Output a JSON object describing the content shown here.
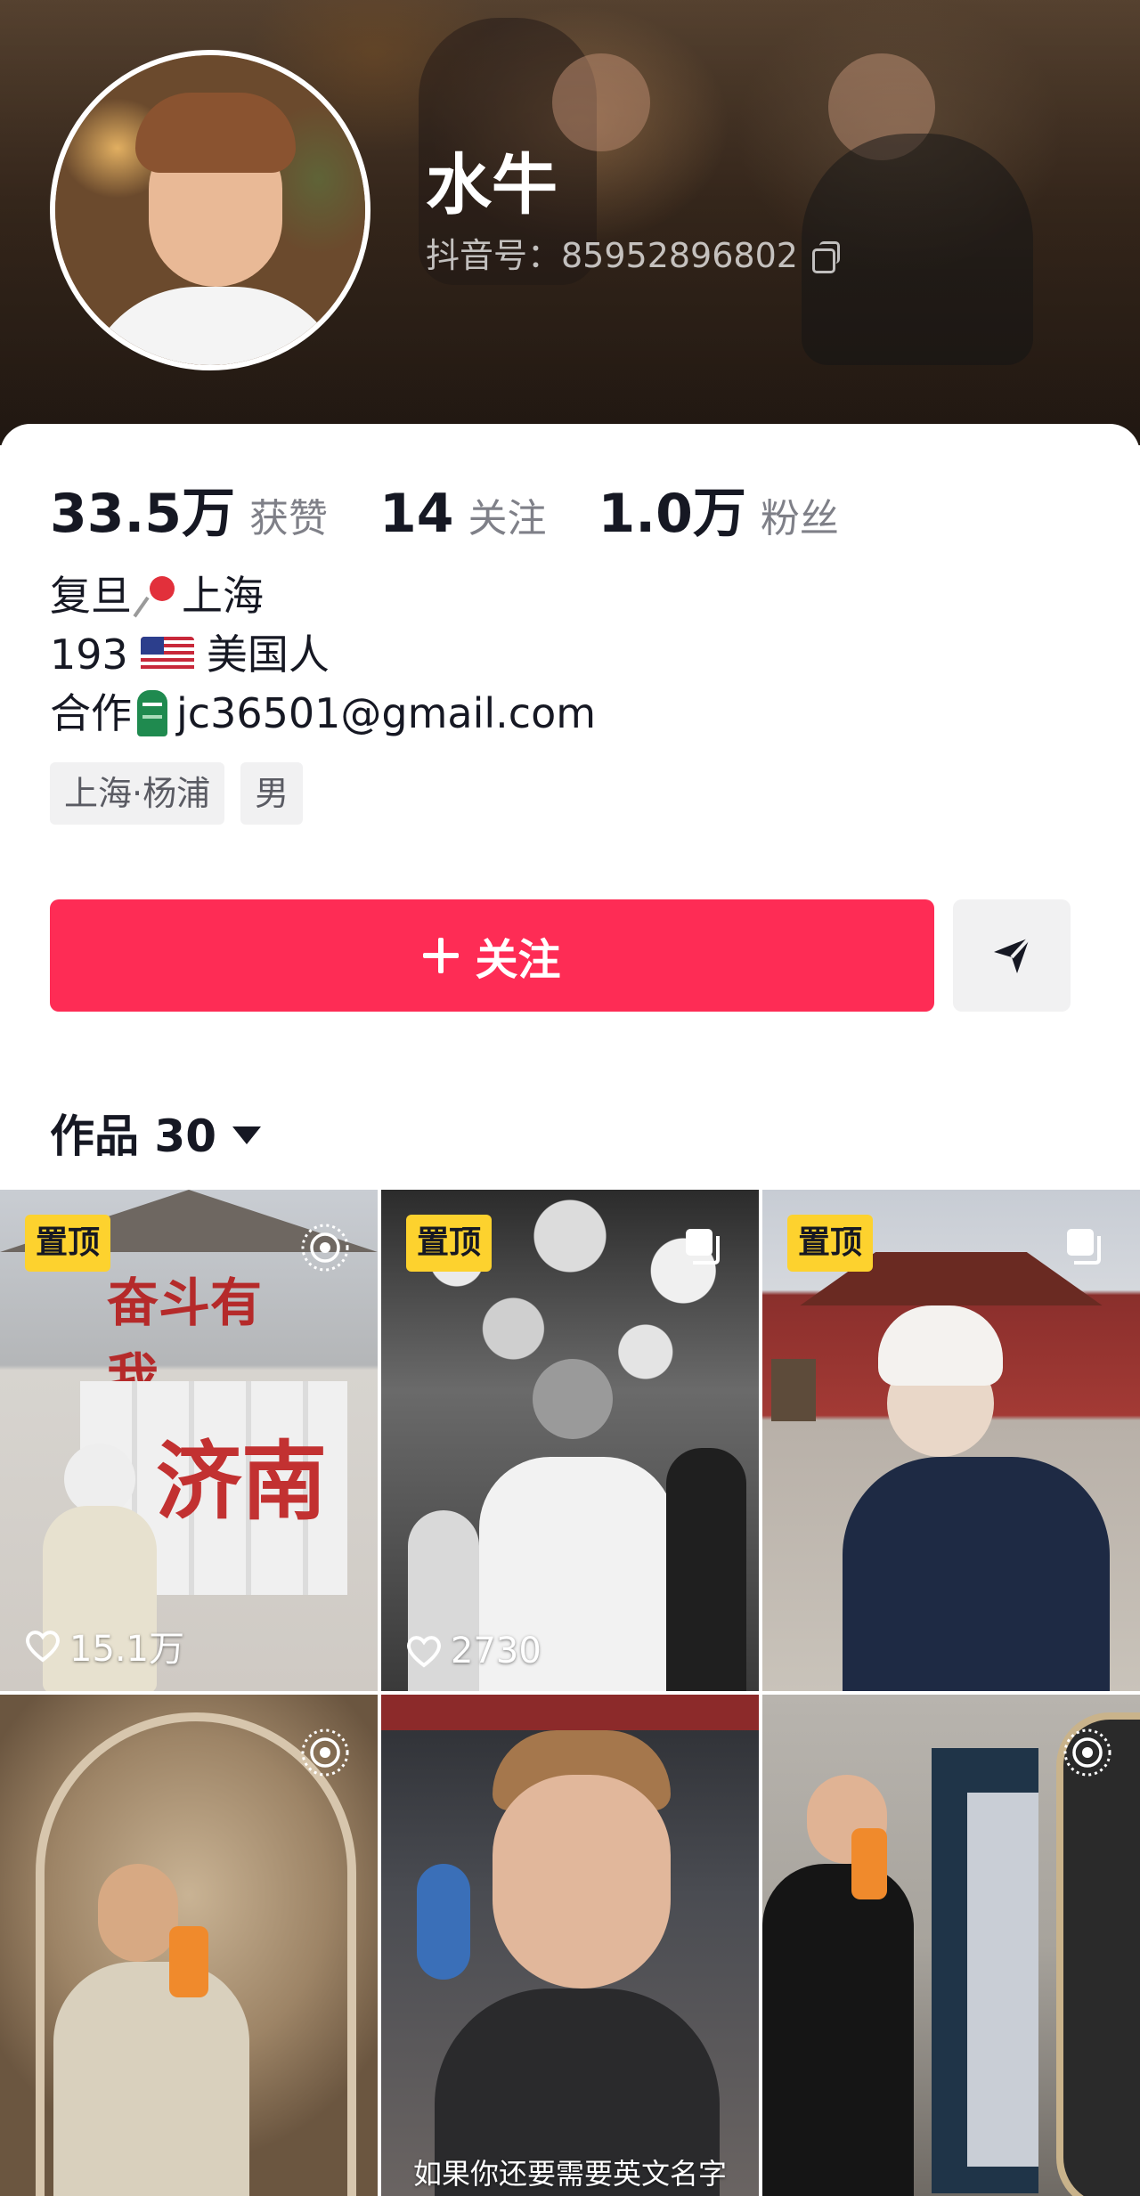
{
  "profile": {
    "name": "水牛",
    "douyin_id": "抖音号：85952896802"
  },
  "stats": {
    "likes_value": "33.5万",
    "likes_label": "获赞",
    "following_value": "14",
    "following_label": "关注",
    "followers_value": "1.0万",
    "followers_label": "粉丝"
  },
  "bio": {
    "line1_a": "复旦",
    "line1_b": "上海",
    "line2_a": "193",
    "line2_b": "美国人",
    "line3_a": "合作",
    "line3_b": "jc36501@gmail.com"
  },
  "tags": [
    "上海·杨浦",
    "男"
  ],
  "actions": {
    "follow_label": "关注"
  },
  "works": {
    "label": "作品 30"
  },
  "grid": {
    "pinned_label": "置顶",
    "items": [
      {
        "likes": "15.1万"
      },
      {
        "likes": "2730"
      },
      {
        "likes": ""
      },
      {
        "likes": ""
      },
      {
        "caption": "如果你还要需要英文名字"
      },
      {
        "likes": ""
      }
    ]
  },
  "colors": {
    "follow_button": "#fe2c55",
    "pinned_badge": "#fdd22e"
  }
}
